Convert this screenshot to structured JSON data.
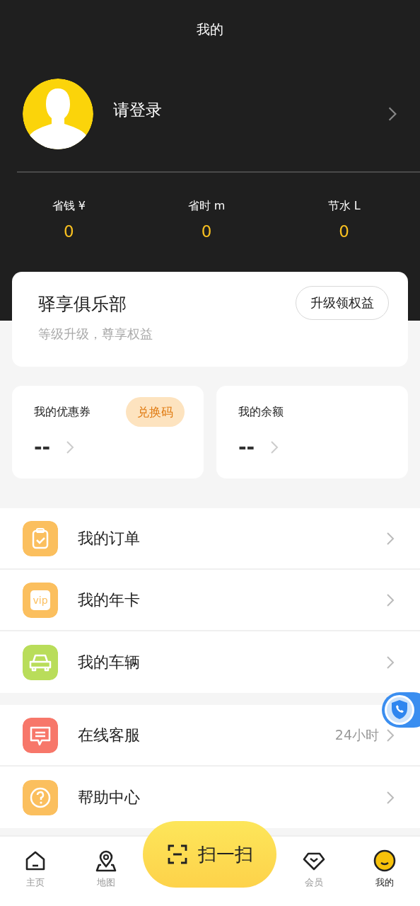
{
  "header": {
    "title": "我的"
  },
  "profile": {
    "name": "请登录"
  },
  "stats": [
    {
      "label": "省钱 ¥",
      "value": "0"
    },
    {
      "label": "省时 m",
      "value": "0"
    },
    {
      "label": "节水 L",
      "value": "0"
    }
  ],
  "club": {
    "title": "驿享俱乐部",
    "subtitle": "等级升级，尊享权益",
    "button": "升级领权益"
  },
  "wallet": [
    {
      "label": "我的优惠券",
      "badge": "兑换码",
      "value": "--"
    },
    {
      "label": "我的余额",
      "value": "--"
    }
  ],
  "menu_groups": [
    [
      {
        "kind": "order",
        "color": "#fbbf5e",
        "label": "我的订单"
      },
      {
        "kind": "vip",
        "color": "#fbbf5e",
        "label": "我的年卡"
      },
      {
        "kind": "car",
        "color": "#b9dd5a",
        "label": "我的车辆"
      }
    ],
    [
      {
        "kind": "service",
        "color": "#f7776a",
        "label": "在线客服",
        "value": "24小时"
      },
      {
        "kind": "help",
        "color": "#fbbf5e",
        "label": "帮助中心"
      }
    ]
  ],
  "tabbar": [
    {
      "kind": "home",
      "label": "主页",
      "selected": false
    },
    {
      "kind": "map",
      "label": "地图",
      "selected": false
    },
    {
      "kind": "scan",
      "label": "扫一扫",
      "selected": false
    },
    {
      "kind": "member",
      "label": "会员",
      "selected": false
    },
    {
      "kind": "mine",
      "label": "我的",
      "selected": true
    }
  ]
}
